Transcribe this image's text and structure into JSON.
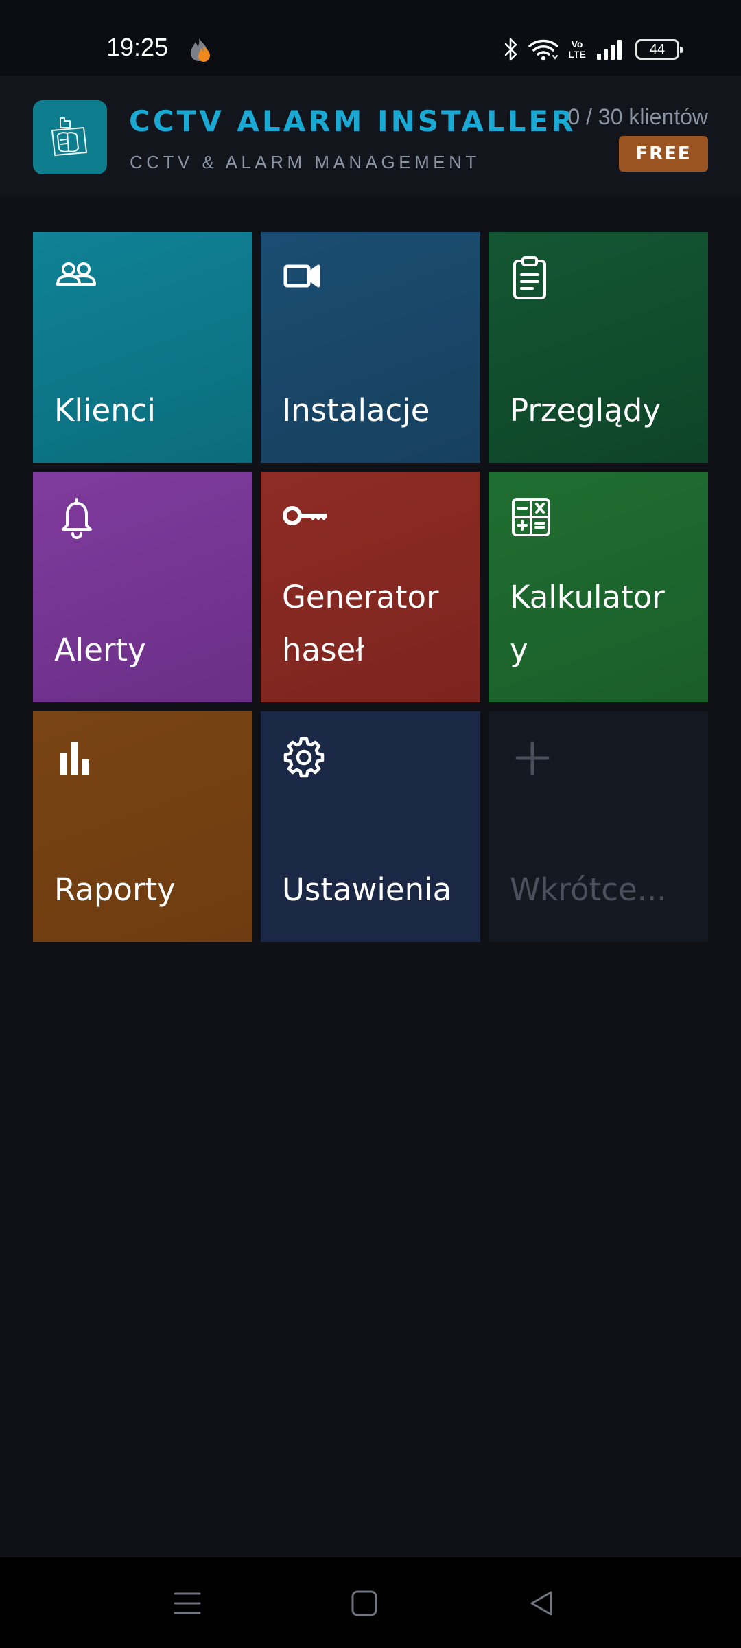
{
  "status_bar": {
    "time": "19:25",
    "notification_icon": "flame-icon",
    "icons": [
      "bluetooth-icon",
      "wifi-icon",
      "volte-icon",
      "signal-icon",
      "battery-icon"
    ],
    "volte_text": "Vo\nLTE",
    "battery_level": "44"
  },
  "header": {
    "title": "CCTV ALARM INSTALLER",
    "subtitle": "CCTV & ALARM MANAGEMENT",
    "client_count": "0 / 30 klientów",
    "plan_badge": "FREE",
    "logo_icon": "app-logo-icon",
    "colors": {
      "title": "#1aa9d3",
      "logo_bg": "#0e7d8e",
      "badge_bg": "#9a5422"
    }
  },
  "tiles": [
    {
      "label": "Klienci",
      "icon": "users-icon",
      "color": "#0f8296"
    },
    {
      "label": "Instalacje",
      "icon": "video-camera-icon",
      "color": "#1b4d72"
    },
    {
      "label": "Przeglądy",
      "icon": "clipboard-icon",
      "color": "#145733"
    },
    {
      "label": "Alerty",
      "icon": "bell-icon",
      "color": "#803b9e"
    },
    {
      "label": "Generator\nhaseł",
      "icon": "key-icon",
      "color": "#8e2c24"
    },
    {
      "label": "Kalkulator\ny",
      "icon": "calculator-icon",
      "color": "#1f6e31"
    },
    {
      "label": "Raporty",
      "icon": "bar-chart-icon",
      "color": "#7a4414"
    },
    {
      "label": "Ustawienia",
      "icon": "gear-icon",
      "color": "#1b2845"
    },
    {
      "label": "Wkrótce...",
      "icon": "plus-icon",
      "color": "#141821"
    }
  ],
  "nav_bar": {
    "buttons": [
      "menu-icon",
      "home-icon",
      "back-icon"
    ]
  }
}
